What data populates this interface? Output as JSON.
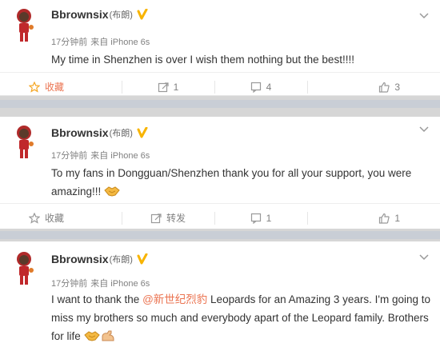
{
  "colors": {
    "accent": "#eb7350",
    "verified": "#f8b400",
    "separator": "#c9ced6"
  },
  "posts": [
    {
      "user": "Bbrownsix",
      "user_cn": "(布朗)",
      "time": "17分钟前",
      "source": "来自 iPhone 6s",
      "text": "My time in Shenzhen is over I wish them nothing but the best!!!!",
      "actions": {
        "favorite": "收藏",
        "repost": "1",
        "comment": "4",
        "like": "3"
      }
    },
    {
      "user": "Bbrownsix",
      "user_cn": "(布朗)",
      "time": "17分钟前",
      "source": "来自 iPhone 6s",
      "text_line1": "To my fans in Dongguan/Shenzhen thank you for all your support, you were",
      "text_line2": "amazing!!!",
      "actions": {
        "favorite": "收藏",
        "repost": "转发",
        "comment": "1",
        "like": "1"
      }
    },
    {
      "user": "Bbrownsix",
      "user_cn": "(布朗)",
      "time": "17分钟前",
      "source": "来自 iPhone 6s",
      "text_prefix": "I want to thank the ",
      "mention": "@新世纪烈豹",
      "text_rest": " Leopards for an Amazing 3 years. I'm going to miss my brothers so much and everybody apart of the Leopard family. Brothers for life "
    }
  ]
}
